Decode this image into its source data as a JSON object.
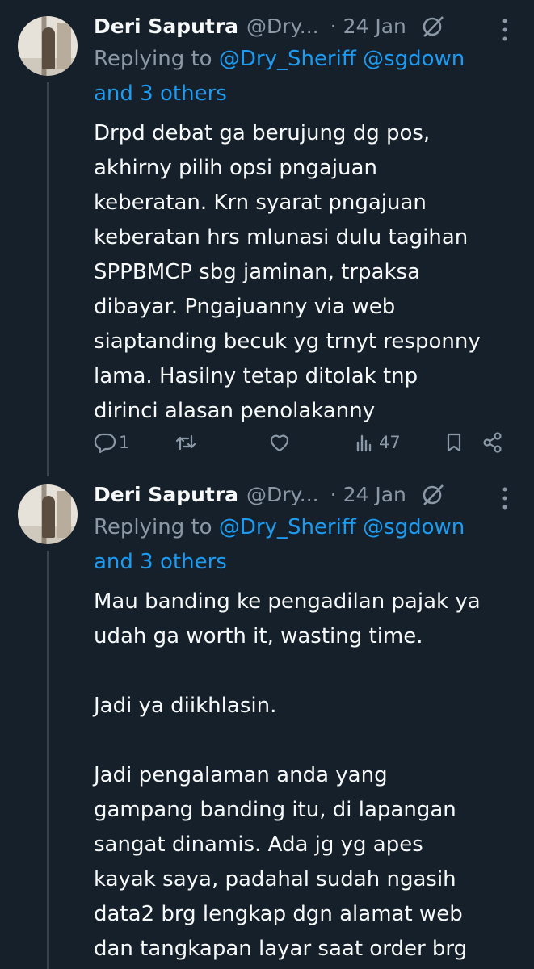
{
  "tweets": [
    {
      "author_name": "Deri Saputra",
      "author_handle": "@Dry...",
      "date": "24 Jan",
      "separator": "·",
      "reply_prefix": "Replying to",
      "reply_mention_1": "@Dry_Sheriff",
      "reply_mention_2": "@sgdown",
      "reply_others": "and 3 others",
      "text_lines": [
        "Drpd debat ga berujung dg pos,",
        "akhirny pilih opsi pngajuan",
        "keberatan. Krn syarat pngajuan",
        "keberatan hrs mlunasi dulu tagihan",
        "SPPBMCP sbg jaminan, trpaksa",
        "dibayar. Pngajuanny via web",
        "siaptanding becuk yg trnyt responny",
        "lama. Hasilny tetap ditolak tnp",
        "dirinci alasan penolakanny"
      ],
      "reply_count": "1",
      "views_count": "47"
    },
    {
      "author_name": "Deri Saputra",
      "author_handle": "@Dry...",
      "date": "24 Jan",
      "separator": "·",
      "reply_prefix": "Replying to",
      "reply_mention_1": "@Dry_Sheriff",
      "reply_mention_2": "@sgdown",
      "reply_others": "and 3 others",
      "paragraphs": [
        [
          "Mau banding ke pengadilan pajak ya",
          "udah ga worth it, wasting time."
        ],
        [
          "Jadi ya diikhlasin."
        ],
        [
          "Jadi pengalaman anda yang",
          "gampang banding itu, di lapangan",
          "sangat dinamis. Ada jg yg apes",
          "kayak saya, padahal sudah ngasih",
          "data2 brg lengkap dgn alamat web",
          "dan tangkapan layar saat order brg"
        ]
      ]
    }
  ],
  "icons": {
    "reply": "reply-icon",
    "retweet": "retweet-icon",
    "like": "heart-icon",
    "views": "views-icon",
    "bookmark": "bookmark-icon",
    "share": "share-icon",
    "grok": "grok-icon",
    "more": "more-icon"
  },
  "colors": {
    "background": "#15202b",
    "text": "#f7f9f9",
    "secondary": "#8b98a5",
    "link": "#1d9bf0",
    "thread_line": "#38444d"
  }
}
